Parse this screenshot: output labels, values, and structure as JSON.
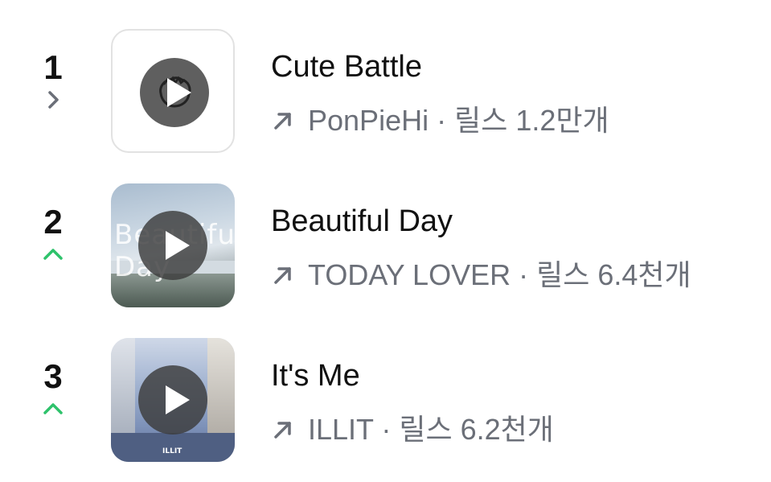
{
  "items": [
    {
      "rank": "1",
      "trend": "same",
      "title": "Cute Battle",
      "artist": "PonPieHi",
      "separator": " · ",
      "count": "릴스 1.2만개",
      "thumb_icon": "monster-face-icon"
    },
    {
      "rank": "2",
      "trend": "up",
      "title": "Beautiful Day",
      "artist": "TODAY LOVER",
      "separator": " · ",
      "count": "릴스 6.4천개",
      "thumb_text": "Beautiful Day"
    },
    {
      "rank": "3",
      "trend": "up",
      "title": "It's Me",
      "artist": "ILLIT",
      "separator": " · ",
      "count": "릴스 6.2천개",
      "thumb_logo": "ILLIT"
    }
  ],
  "colors": {
    "up": "#2ec26b",
    "same": "#6b6f78",
    "title": "#111111",
    "meta": "#6b6f78"
  }
}
